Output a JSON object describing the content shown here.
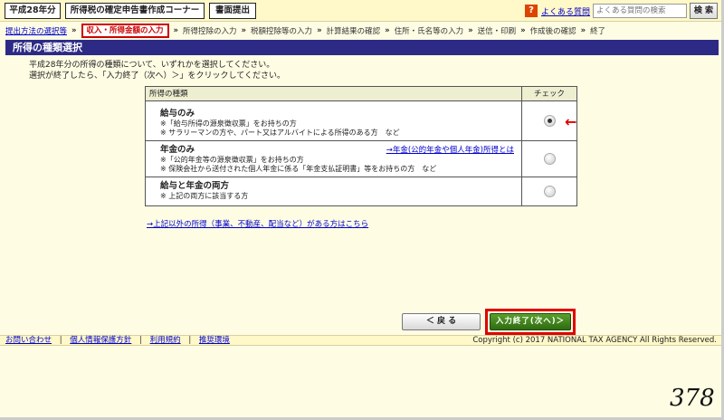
{
  "header": {
    "year_label": "平成28年分",
    "corner_title": "所得税の確定申告書作成コーナー",
    "submit_label": "書面提出",
    "faq_icon": "?",
    "faq_link": "よくある質問",
    "search_placeholder": "よくある質問の検索",
    "search_button": "検 索"
  },
  "steps": [
    {
      "label": "提出方法の選択等",
      "state": "done"
    },
    {
      "label": "収入・所得金額の入力",
      "state": "current"
    },
    {
      "label": "所得控除の入力",
      "state": "todo"
    },
    {
      "label": "税額控除等の入力",
      "state": "todo"
    },
    {
      "label": "計算結果の確認",
      "state": "todo"
    },
    {
      "label": "住所・氏名等の入力",
      "state": "todo"
    },
    {
      "label": "送信・印刷",
      "state": "todo"
    },
    {
      "label": "作成後の確認",
      "state": "todo"
    },
    {
      "label": "終了",
      "state": "todo"
    }
  ],
  "step_separator": "»",
  "page_title": "所得の種類選択",
  "instructions": {
    "line1": "平成28年分の所得の種類について、いずれかを選択してください。",
    "line2": "選択が終了したら、「入力終了（次へ）＞」をクリックしてください。"
  },
  "table": {
    "col_type": "所得の種類",
    "col_check": "チェック",
    "rows": [
      {
        "name": "給与のみ",
        "notes": [
          "※「給与所得の源泉徴収票」をお持ちの方",
          "※ サラリーマンの方や、パート又はアルバイトによる所得のある方　など"
        ],
        "link": "",
        "checked": true
      },
      {
        "name": "年金のみ",
        "notes": [
          "※「公的年金等の源泉徴収票」をお持ちの方",
          "※ 保険会社から送付された個人年金に係る「年金支払証明書」等をお持ちの方　など"
        ],
        "link": "→年金(公的年金や個人年金)所得とは",
        "checked": false
      },
      {
        "name": "給与と年金の両方",
        "notes": [
          "※ 上記の両方に該当する方"
        ],
        "link": "",
        "checked": false
      }
    ]
  },
  "arrow_annotation": "←",
  "other_income_link": "→上記以外の所得（事業、不動産、配当など）がある方はこちら",
  "back_button": "＜ 戻 る",
  "next_button": "入力終了(次へ)＞",
  "footer": {
    "links": [
      "お問い合わせ",
      "個人情報保護方針",
      "利用規約",
      "推奨環境"
    ],
    "separator": "|",
    "copyright": "Copyright (c) 2017 NATIONAL TAX AGENCY All Rights Reserved."
  },
  "page_number": "378"
}
